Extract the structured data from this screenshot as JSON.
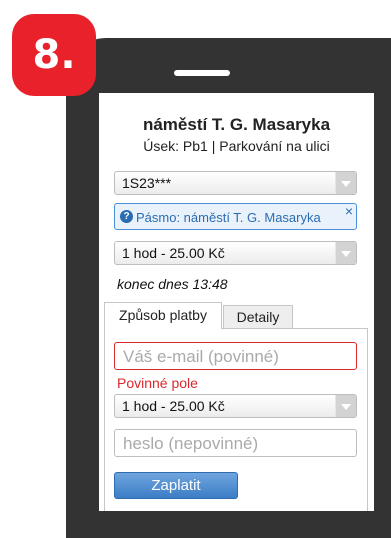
{
  "step_label": "8.",
  "header": {
    "title": "náměstí T. G. Masaryka",
    "subtitle": "Úsek: Pb1 | Parkování na ulici"
  },
  "plate_select": {
    "value": "1S23***"
  },
  "zone_info": {
    "text": "Pásmo: náměstí T. G. Masaryka",
    "icon": "question-circle-icon",
    "close": "×"
  },
  "duration_select": {
    "value": "1 hod - 25.00 Kč"
  },
  "end_note": "konec dnes 13:48",
  "tabs": [
    {
      "label": "Způsob platby",
      "active": true
    },
    {
      "label": "Detaily",
      "active": false
    }
  ],
  "payment": {
    "email_placeholder": "Váš e-mail (povinné)",
    "email_error": "Povinné pole",
    "duration_value": "1 hod - 25.00 Kč",
    "password_placeholder": "heslo (nepovinné)",
    "pay_label": "Zaplatit"
  },
  "colors": {
    "badge": "#e8212b",
    "phone": "#333333",
    "accent": "#3c7dc6",
    "error": "#d9292e"
  }
}
